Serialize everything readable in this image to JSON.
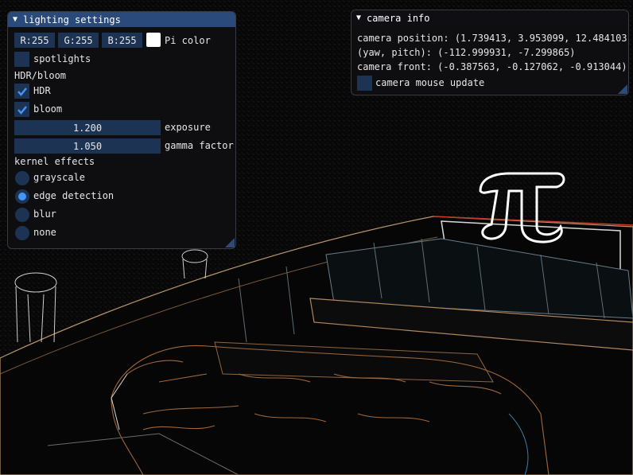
{
  "lighting": {
    "title": "lighting settings",
    "rgb": [
      "R:255",
      "G:255",
      "B:255"
    ],
    "pi_color_label": "Pi color",
    "spotlights_label": "spotlights",
    "spotlights_checked": false,
    "hdr_section": "HDR/bloom",
    "hdr_label": "HDR",
    "hdr_checked": true,
    "bloom_label": "bloom",
    "bloom_checked": true,
    "exposure_value": "1.200",
    "exposure_label": "exposure",
    "gamma_value": "1.050",
    "gamma_label": "gamma factor",
    "kernel_section": "kernel effects",
    "kernels": [
      {
        "label": "grayscale",
        "selected": false
      },
      {
        "label": "edge detection",
        "selected": true
      },
      {
        "label": "blur",
        "selected": false
      },
      {
        "label": "none",
        "selected": false
      }
    ]
  },
  "camera": {
    "title": "camera info",
    "position": "camera position: (1.739413, 3.953099, 12.484103)",
    "yaw_pitch": "(yaw, pitch): (-112.999931, -7.299865)",
    "front": "camera front: (-0.387563, -0.127062, -0.913044)",
    "mouse_update_label": "camera mouse update",
    "mouse_update_checked": false
  },
  "colors": {
    "accent": "#4296fa",
    "frame_bg": "#1d3353",
    "title_active": "#294a7a",
    "pi_color": "#ffffff"
  }
}
